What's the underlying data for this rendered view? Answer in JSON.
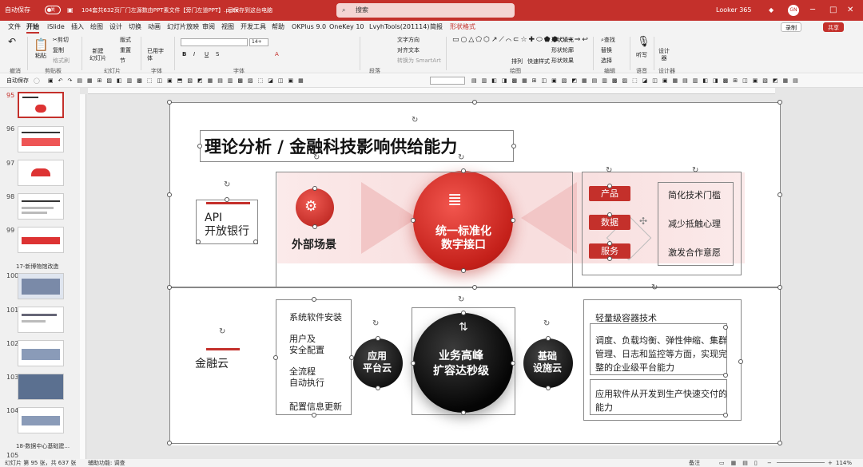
{
  "titlebar": {
    "autosave_label": "自动保存",
    "autosave_state": "关",
    "file_name": "104套共632页厂门左源数由PPT素文件【旁门左道PPT】.pptx",
    "saved_state": "已保存到这台电脑",
    "search_placeholder": "搜索",
    "looker": "Looker 365",
    "avatar": "GN"
  },
  "menu": [
    "文件",
    "开始",
    "iSlide",
    "插入",
    "绘图",
    "设计",
    "切换",
    "动画",
    "幻灯片放映",
    "审阅",
    "视图",
    "开发工具",
    "帮助",
    "OKPlus 9.0",
    "OneKey 10",
    "LvyhTools(201114)",
    "简报",
    "形状格式"
  ],
  "menu_active": "开始",
  "record_btn": "录制",
  "share_btn": "共享",
  "ribbon": {
    "paste": "粘贴",
    "cut": "剪切",
    "copy": "复制",
    "format_painter": "格式刷",
    "new_slide": "新建\n幻灯片",
    "layout": "版式",
    "reset": "重置",
    "section": "节",
    "used_font": "已用字体",
    "text_direction": "文字方向",
    "align_text": "对齐文本",
    "smartart": "转换为 SmartArt",
    "arrange": "排列",
    "quick_styles": "快速样式",
    "shape_fill": "形状填充",
    "shape_outline": "形状轮廓",
    "shape_effects": "形状效果",
    "find": "查找",
    "replace": "替换",
    "select": "选择",
    "dictate": "听写",
    "designer": "设计\n器",
    "groups": [
      "撤消",
      "剪贴板",
      "幻灯片",
      "字体",
      "字体",
      "段落",
      "绘图",
      "编辑",
      "语音",
      "设计器"
    ],
    "font_size": "14+"
  },
  "qat_label": "自动保存",
  "thumbs": [
    {
      "num": "95"
    },
    {
      "num": "96"
    },
    {
      "num": "97"
    },
    {
      "num": "98"
    },
    {
      "num": "99"
    },
    {
      "num": "100"
    },
    {
      "num": "101"
    },
    {
      "num": "102"
    },
    {
      "num": "103"
    },
    {
      "num": "104"
    },
    {
      "num": "105"
    }
  ],
  "sections": [
    "17-新博物馆改造",
    "18-数据中心基础建..."
  ],
  "slide": {
    "title": "理论分析 / 金融科技影响供给能力",
    "api": "API\n开放银行",
    "external": "外部场景",
    "center1": "统一标准化\n数字接口",
    "pills": [
      "产品",
      "数据",
      "服务"
    ],
    "right_labels": [
      "简化技术门槛",
      "减少抵触心理",
      "激发合作意愿"
    ],
    "finance_cloud": "金融云",
    "left_list": [
      "系统软件安装",
      "用户及\n安全配置",
      "全流程\n自动执行",
      "配置信息更新"
    ],
    "platform_cloud": "应用\n平台云",
    "center2": "业务高峰\n扩容达秒级",
    "infra_cloud": "基础\n设施云",
    "right_text1": "轻量级容器技术",
    "right_text2": "调度、负载均衡、弹性伸缩、集群管理、日志和监控等方面，实现完整的企业级平台能力",
    "right_text3": "应用软件从开发到生产快速交付的能力"
  },
  "status": {
    "slide_info": "幻灯片 第 95 张，共 637 张",
    "accessibility": "辅助功能: 调查",
    "notes": "备注",
    "zoom": "114%"
  }
}
